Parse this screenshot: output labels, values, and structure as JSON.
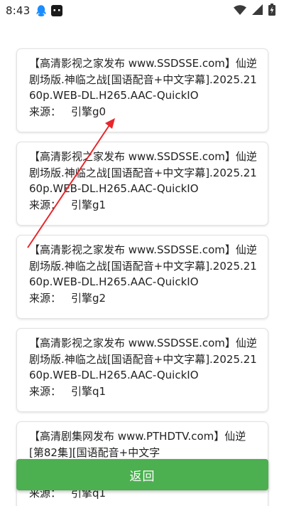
{
  "status_bar": {
    "time": "8:43",
    "icons": [
      "qq-icon",
      "app-notification-icon",
      "wifi-icon",
      "signal-icon",
      "battery-charging-icon"
    ]
  },
  "results": [
    {
      "title": "【高清影视之家发布 www.SSDSSE.com】仙逆剧场版.神临之战[国语配音+中文字幕].2025.2160p.WEB-DL.H265.AAC-QuickIO",
      "source_label": "来源：",
      "source_value": "引擎g0"
    },
    {
      "title": "【高清影视之家发布 www.SSDSSE.com】仙逆剧场版.神临之战[国语配音+中文字幕].2025.2160p.WEB-DL.H265.AAC-QuickIO",
      "source_label": "来源：",
      "source_value": "引擎g1"
    },
    {
      "title": "【高清影视之家发布 www.SSDSSE.com】仙逆剧场版.神临之战[国语配音+中文字幕].2025.2160p.WEB-DL.H265.AAC-QuickIO",
      "source_label": "来源：",
      "source_value": "引擎g2"
    },
    {
      "title": "【高清影视之家发布 www.SSDSSE.com】仙逆剧场版.神临之战[国语配音+中文字幕].2025.2160p.WEB-DL.H265.AAC-QuickIO",
      "source_label": "来源：",
      "source_value": "引擎q1"
    },
    {
      "title": "【高清剧集网发布 www.PTHDTV.com】仙逆[第82集][国语配音+中文字",
      "source_label": "来源：",
      "source_value": "引擎q1"
    }
  ],
  "back_button": {
    "label": "返回"
  },
  "colors": {
    "accent": "#4caf50",
    "annotation_arrow": "#e8262b"
  }
}
